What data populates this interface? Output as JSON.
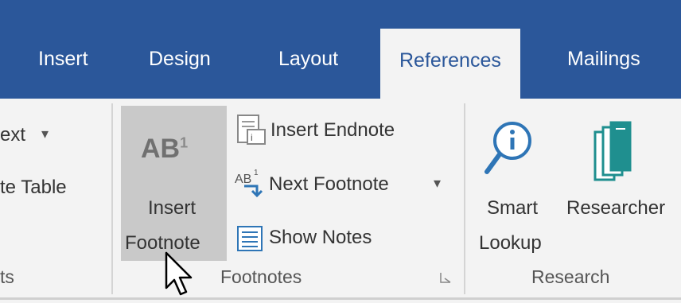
{
  "tabs": [
    {
      "label": "Insert"
    },
    {
      "label": "Design"
    },
    {
      "label": "Layout"
    },
    {
      "label": "References"
    },
    {
      "label": "Mailings"
    }
  ],
  "active_tab": "References",
  "left_group": {
    "item1": "ext",
    "item2": "te Table",
    "label": "ts"
  },
  "footnotes": {
    "insert_footnote_line1": "Insert",
    "insert_footnote_line2": "Footnote",
    "icon_text": "AB",
    "icon_sup": "1",
    "insert_endnote": "Insert Endnote",
    "next_footnote": "Next Footnote",
    "show_notes": "Show Notes",
    "label": "Footnotes"
  },
  "research": {
    "smart_lookup_line1": "Smart",
    "smart_lookup_line2": "Lookup",
    "researcher": "Researcher",
    "label": "Research"
  },
  "colors": {
    "tab_bar": "#2b579a",
    "ribbon": "#f3f3f3",
    "highlight": "#c9c9c9",
    "icon_blue": "#2e75b6",
    "researcher_teal": "#1f8f8f"
  },
  "icons": [
    "insert-endnote-icon",
    "next-footnote-icon",
    "show-notes-icon",
    "smart-lookup-icon",
    "researcher-icon",
    "mouse-cursor-icon",
    "dialog-launcher-icon"
  ]
}
